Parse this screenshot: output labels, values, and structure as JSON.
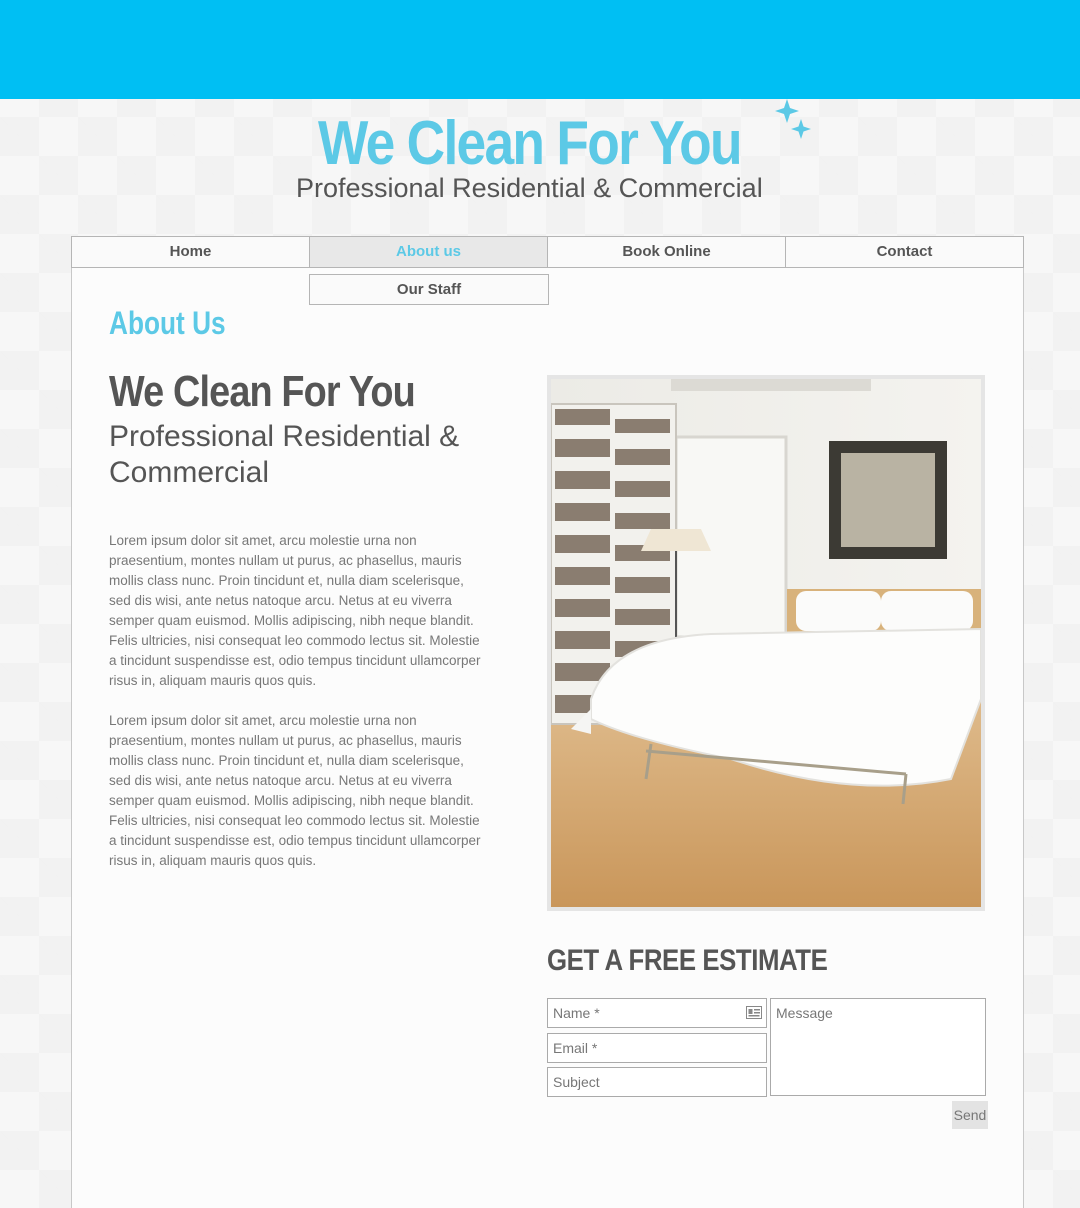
{
  "header": {
    "title": "We Clean For You",
    "subtitle": "Professional Residential & Commercial"
  },
  "nav": {
    "items": [
      {
        "label": "Home"
      },
      {
        "label": "About us"
      },
      {
        "label": "Book Online"
      },
      {
        "label": "Contact"
      }
    ],
    "active": "About us",
    "submenu": {
      "label": "Our Staff"
    }
  },
  "main": {
    "section_heading": "About Us",
    "title": "We Clean For You",
    "subtitle": "Professional Residential & Commercial",
    "paragraphs": [
      "Lorem ipsum dolor sit amet, arcu molestie urna non praesentium, montes nullam ut purus, ac phasellus, mauris mollis class nunc. Proin tincidunt et, nulla diam scelerisque, sed dis wisi, ante netus natoque arcu. Netus at eu viverra semper quam euismod. Mollis adipiscing, nibh neque blandit. Felis ultricies, nisi consequat leo commodo lectus sit. Molestie a tincidunt suspendisse est, odio tempus tincidunt ullamcorper risus in, aliquam mauris quos quis.",
      "Lorem ipsum dolor sit amet, arcu molestie urna non praesentium, montes nullam ut purus, ac phasellus, mauris mollis class nunc. Proin tincidunt et, nulla diam scelerisque, sed dis wisi, ante netus natoque arcu. Netus at eu viverra semper quam euismod. Mollis adipiscing, nibh neque blandit. Felis ultricies, nisi consequat leo commodo lectus sit. Molestie a tincidunt suspendisse est, odio tempus tincidunt ullamcorper risus in, aliquam mauris quos quis."
    ]
  },
  "estimate_form": {
    "title": "GET A FREE ESTIMATE",
    "name_placeholder": "Name *",
    "email_placeholder": "Email *",
    "subject_placeholder": "Subject",
    "message_placeholder": "Message",
    "send_label": "Send"
  },
  "colors": {
    "brand": "#00bff3",
    "accent": "#5cc9e6",
    "text": "#555555"
  },
  "icons": {
    "sparkles": "sparkles-icon",
    "name_card": "id-card-icon"
  }
}
